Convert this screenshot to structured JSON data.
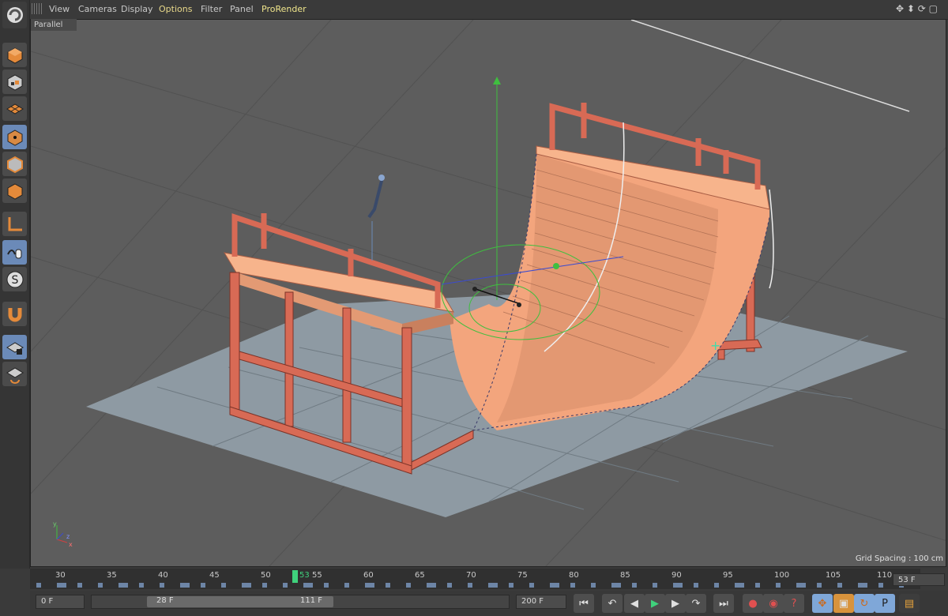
{
  "menubar": {
    "items": [
      "View",
      "Cameras",
      "Display",
      "Options",
      "Filter",
      "Panel",
      "ProRender"
    ]
  },
  "viewport": {
    "camera_label": "Parallel",
    "grid_spacing": "Grid Spacing : 100 cm",
    "axis_labels": {
      "y": "y",
      "z": "z",
      "x": "x"
    }
  },
  "timeline": {
    "ticks": [
      "30",
      "35",
      "40",
      "45",
      "50",
      "55",
      "60",
      "65",
      "70",
      "75",
      "80",
      "85",
      "90",
      "95",
      "100",
      "105",
      "110"
    ],
    "current_frame_marker": "53",
    "frame_field": "53 F"
  },
  "transport": {
    "start_field": "0 F",
    "range_start": "28 F",
    "range_end": "111 F",
    "end_field": "200 F"
  },
  "colors": {
    "ramp_fill": "#f3a57d",
    "frame_red": "#d86a55",
    "floor": "#8e9aa3",
    "accent_active": "#6b8ab8",
    "playhead": "#3fd17c"
  },
  "icons": {
    "toolbar": [
      "undo-icon",
      "cube-model-icon",
      "checker-texture-icon",
      "polygon-plane-icon",
      "points-mode-icon",
      "edges-mode-icon",
      "polygons-mode-icon",
      "axis-icon",
      "live-select-icon",
      "snap-icon",
      "magnet-icon",
      "workplane-lock-icon",
      "workplane-rotate-icon"
    ]
  }
}
